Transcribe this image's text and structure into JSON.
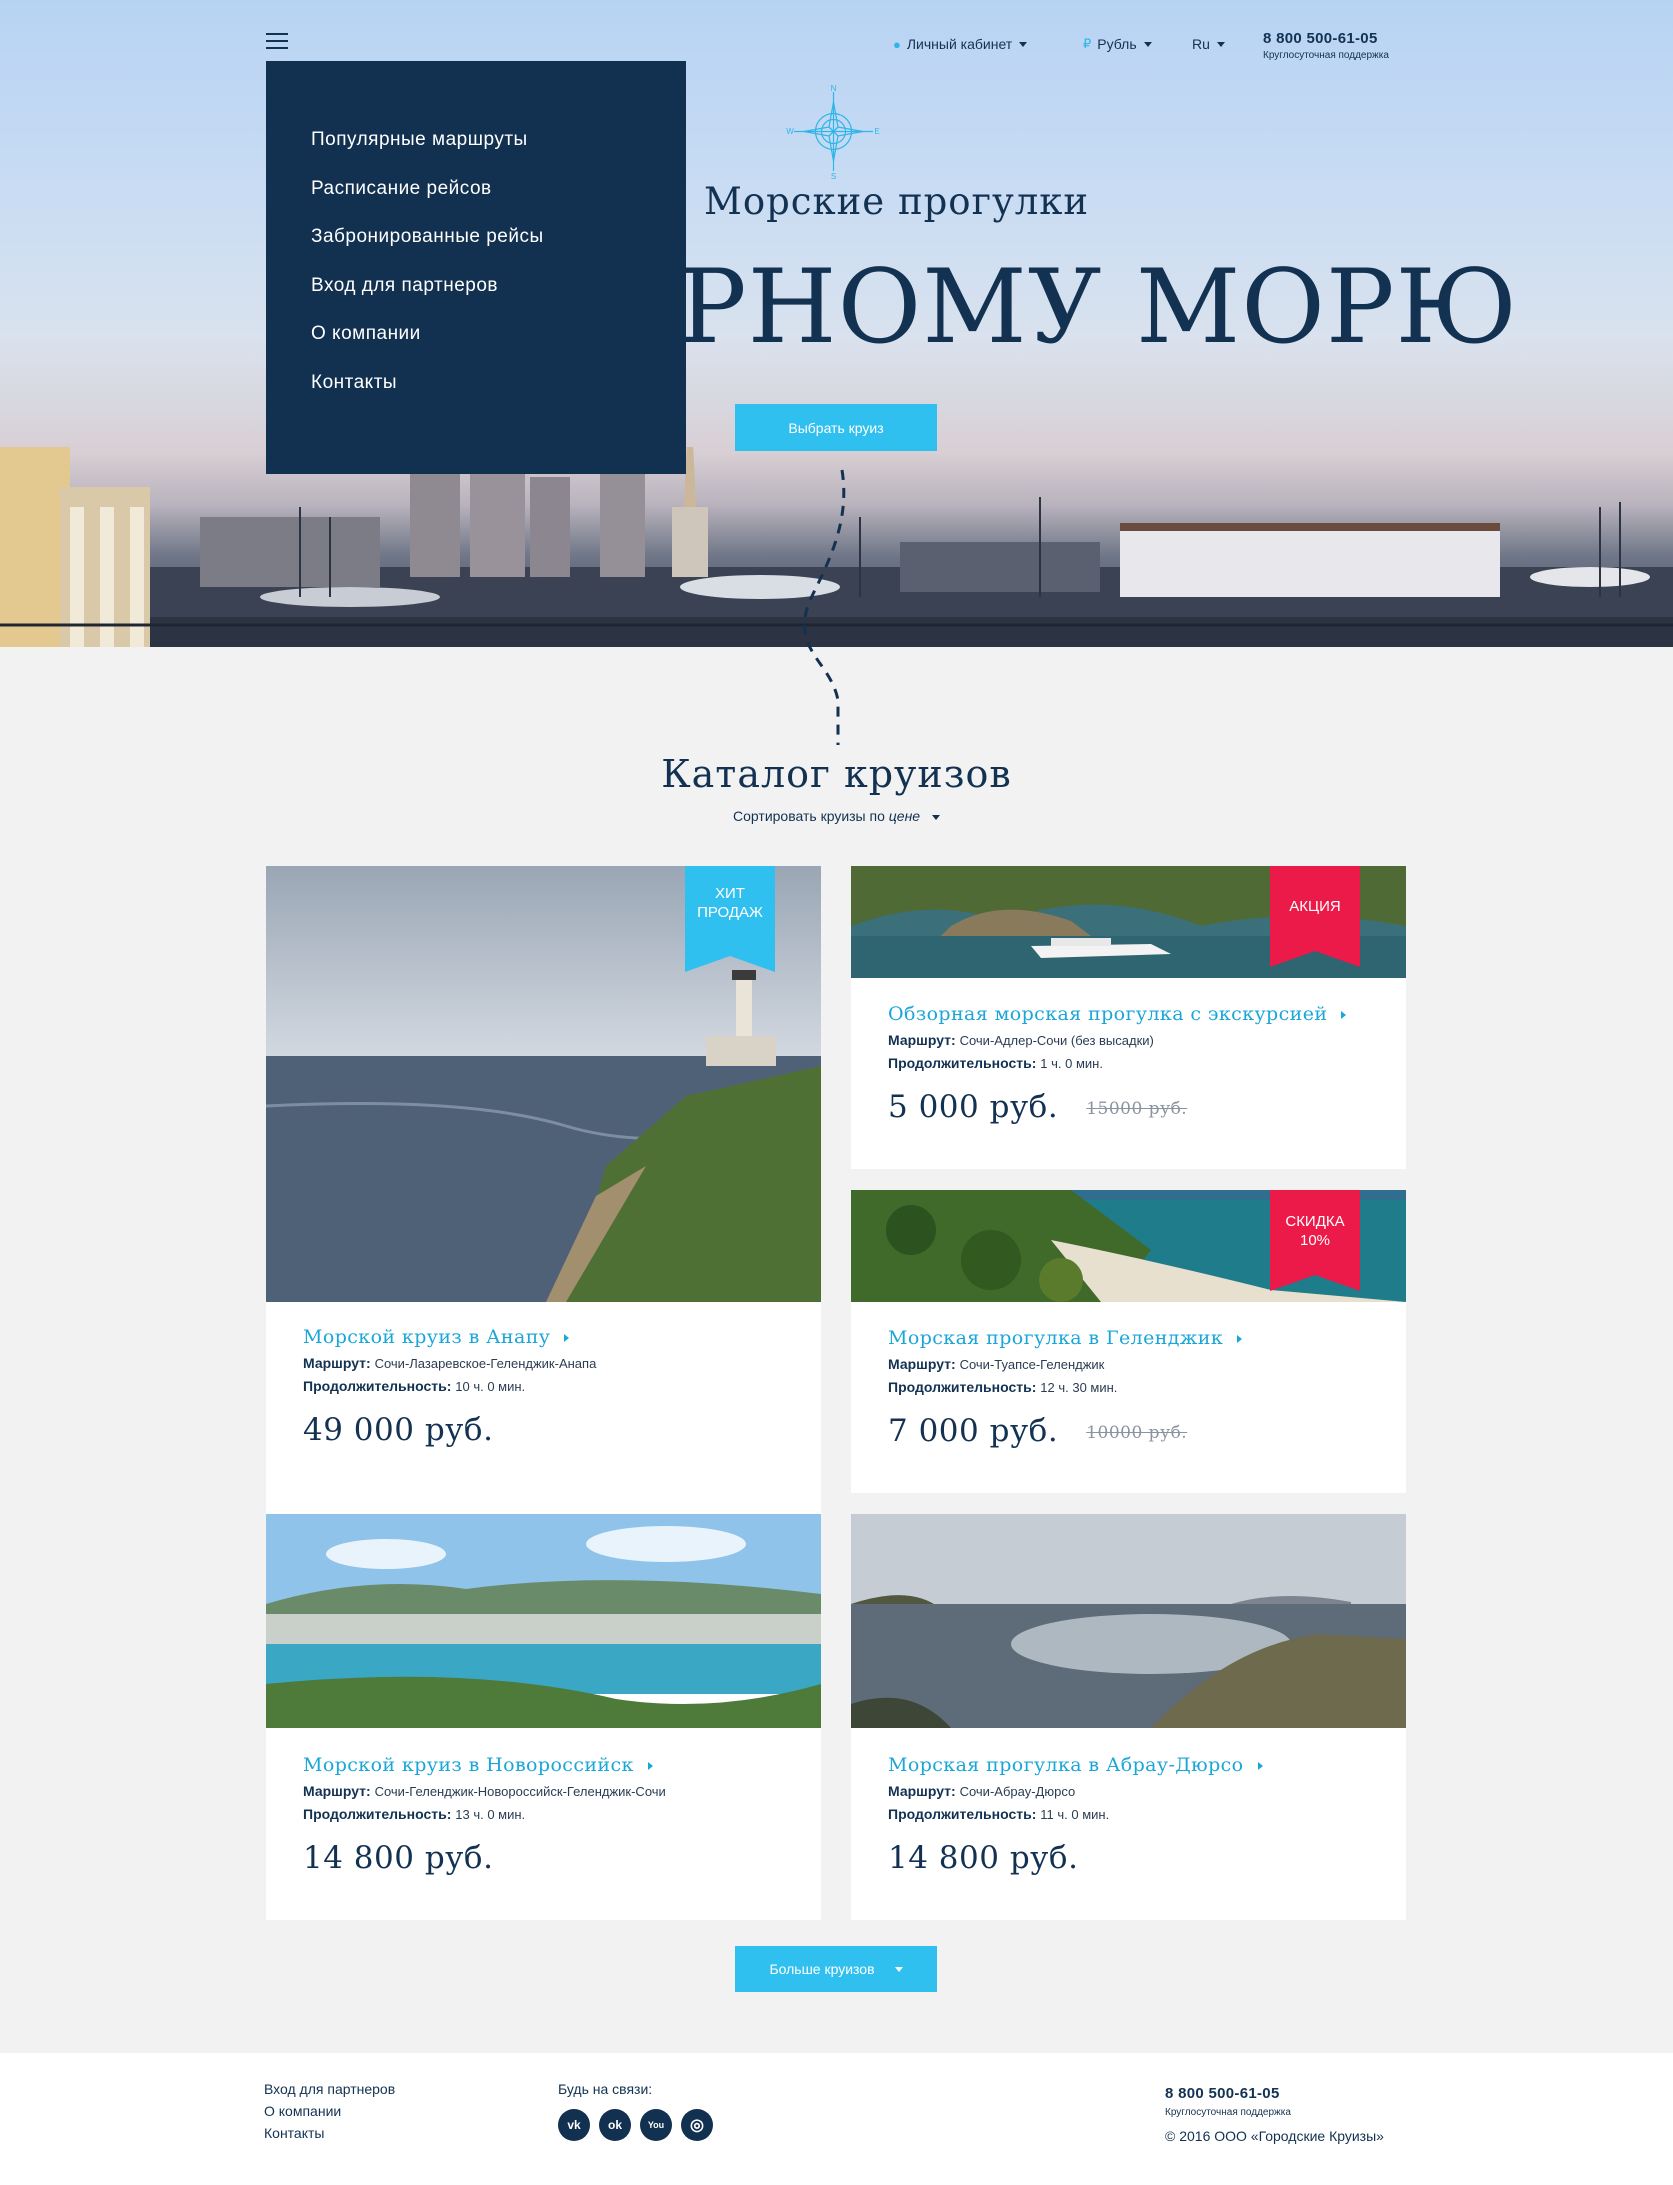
{
  "header": {
    "account": "Личный кабинет",
    "currency": "Рубль",
    "currency_symbol": "₽",
    "language": "Ru",
    "phone": "8 800 500-61-05",
    "phone_note": "Круглосуточная поддержка"
  },
  "hero": {
    "subtitle": "Морские прогулки",
    "title": "ПО ЧЕРНОМУ МОРЮ",
    "button": "Выбрать круиз",
    "compass_letters": [
      "N",
      "E",
      "S",
      "W"
    ]
  },
  "menu": {
    "items": [
      "Популярные маршруты",
      "Расписание рейсов",
      "Забронированные рейсы",
      "Вход для партнеров",
      "О компании",
      "Контакты"
    ]
  },
  "catalog": {
    "title": "Каталог круизов",
    "sort_prefix": "Сортировать круизы по",
    "sort_value": "цене",
    "route_label": "Маршрут:",
    "duration_label": "Продолжительность:",
    "cards": [
      {
        "name": "Морской круиз в Анапу",
        "route": "Сочи-Лазаревское-Геленджик-Анапа",
        "duration": "10 ч. 0 мин.",
        "price": "49 000 руб.",
        "old_price": "",
        "badge": "ХИТ ПРОДАЖ",
        "badge_color": "#2fc0f0"
      },
      {
        "name": "Обзорная морская прогулка с экскурсией",
        "route": "Сочи-Адлер-Сочи (без высадки)",
        "duration": "1 ч. 0 мин.",
        "price": "5 000 руб.",
        "old_price": "15000 руб.",
        "badge": "АКЦИЯ",
        "badge_color": "#eb1a48"
      },
      {
        "name": "Морская прогулка в Геленджик",
        "route": "Сочи-Туапсе-Геленджик",
        "duration": "12 ч. 30 мин.",
        "price": "7 000 руб.",
        "old_price": "10000 руб.",
        "badge": "СКИДКА 10%",
        "badge_color": "#eb1a48"
      },
      {
        "name": "Морской круиз в Новороссийск",
        "route": "Сочи-Геленджик-Новороссийск-Геленджик-Сочи",
        "duration": "13 ч. 0 мин.",
        "price": "14 800 руб.",
        "old_price": "",
        "badge": "",
        "badge_color": ""
      },
      {
        "name": "Морская прогулка в Абрау-Дюрсо",
        "route": "Сочи-Абрау-Дюрсо",
        "duration": "11 ч. 0 мин.",
        "price": "14 800 руб.",
        "old_price": "",
        "badge": "",
        "badge_color": ""
      }
    ],
    "more_button": "Больше круизов"
  },
  "footer": {
    "links": [
      "Вход для партнеров",
      "О компании",
      "Контакты"
    ],
    "social_title": "Будь на связи:",
    "social": [
      {
        "icon": "vk-icon",
        "glyph": "vk"
      },
      {
        "icon": "odnoklassniki-icon",
        "glyph": "ok"
      },
      {
        "icon": "youtube-icon",
        "glyph": "You"
      },
      {
        "icon": "instagram-icon",
        "glyph": "◎"
      }
    ],
    "phone": "8 800 500-61-05",
    "phone_note": "Круглосуточная поддержка",
    "copyright": "© 2016 ООО «Городские Круизы»"
  }
}
